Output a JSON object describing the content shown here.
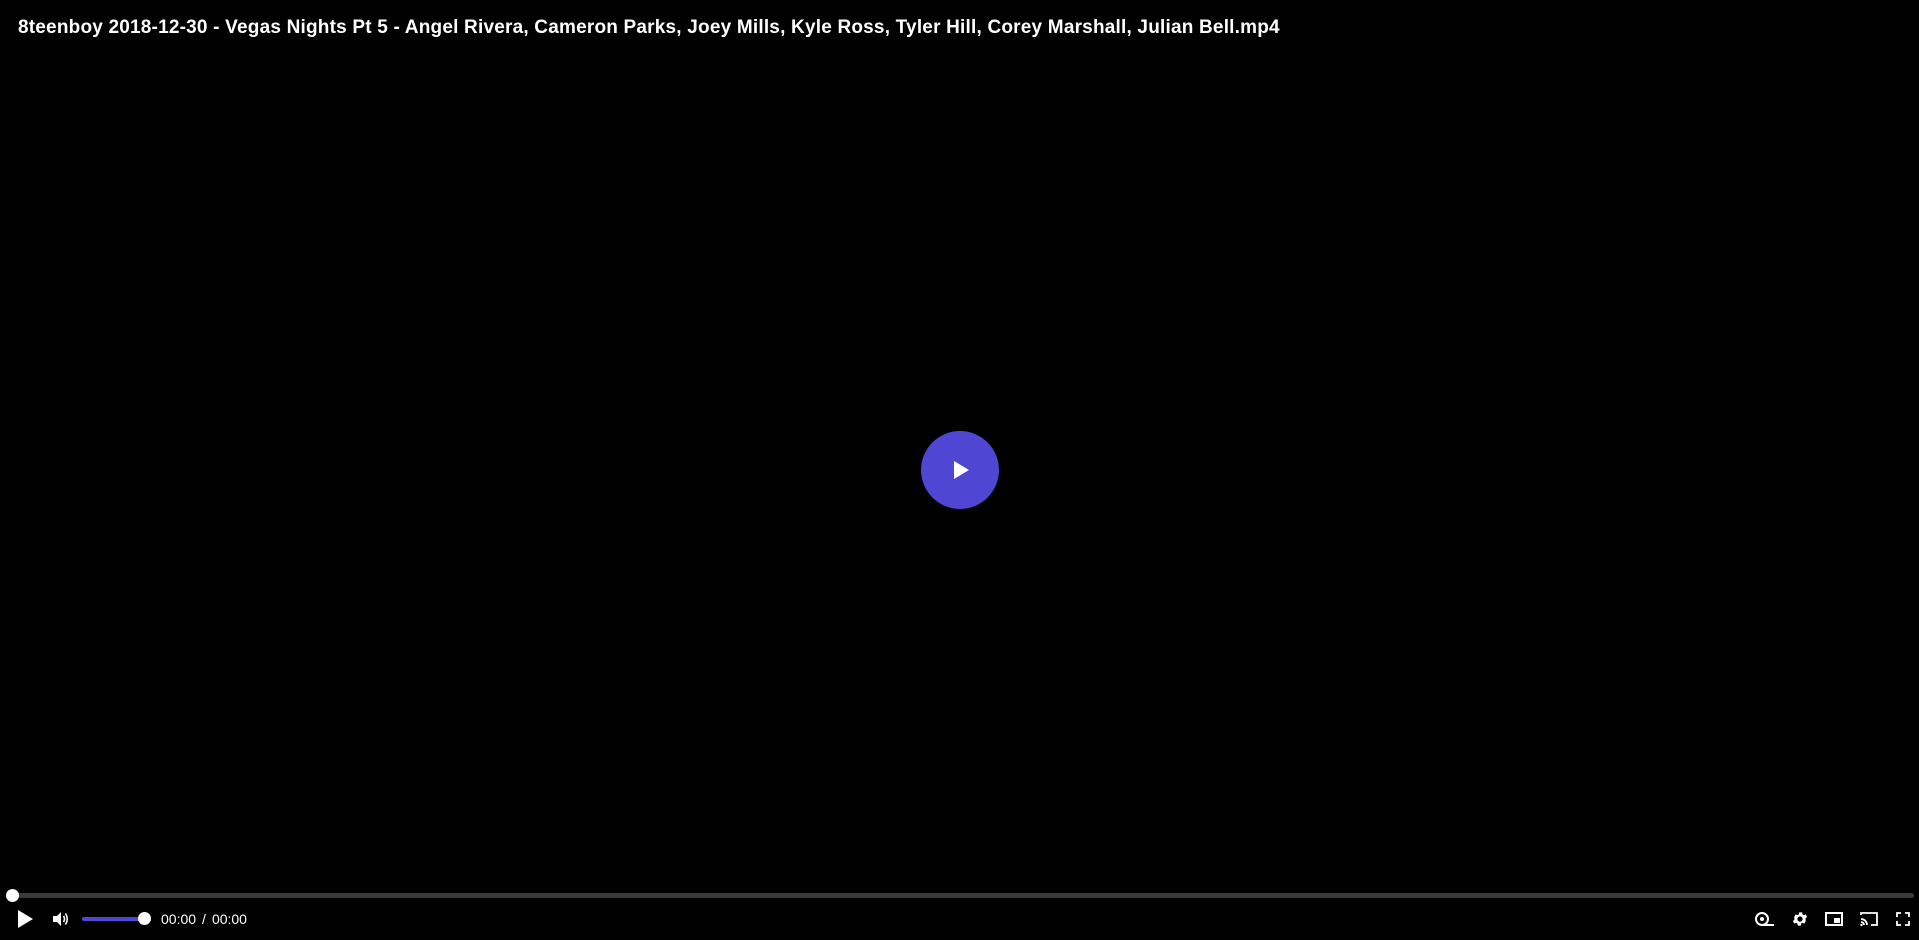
{
  "video": {
    "title": "8teenboy 2018-12-30 - Vegas Nights Pt 5 - Angel Rivera, Cameron Parks, Joey Mills, Kyle Ross, Tyler Hill, Corey Marshall, Julian Bell.mp4"
  },
  "controls": {
    "current_time": "00:00",
    "time_separator": "/",
    "duration": "00:00",
    "progress_fraction": 0,
    "volume_fraction": 1
  },
  "icons": {
    "big_play": "play-icon",
    "play": "play-icon",
    "volume": "volume-icon",
    "speed": "playback-speed-icon",
    "settings": "gear-icon",
    "pip": "picture-in-picture-icon",
    "cast": "cast-icon",
    "fullscreen": "fullscreen-icon"
  },
  "colors": {
    "accent": "#4f46d3",
    "background": "#000000",
    "text": "#ffffff"
  }
}
